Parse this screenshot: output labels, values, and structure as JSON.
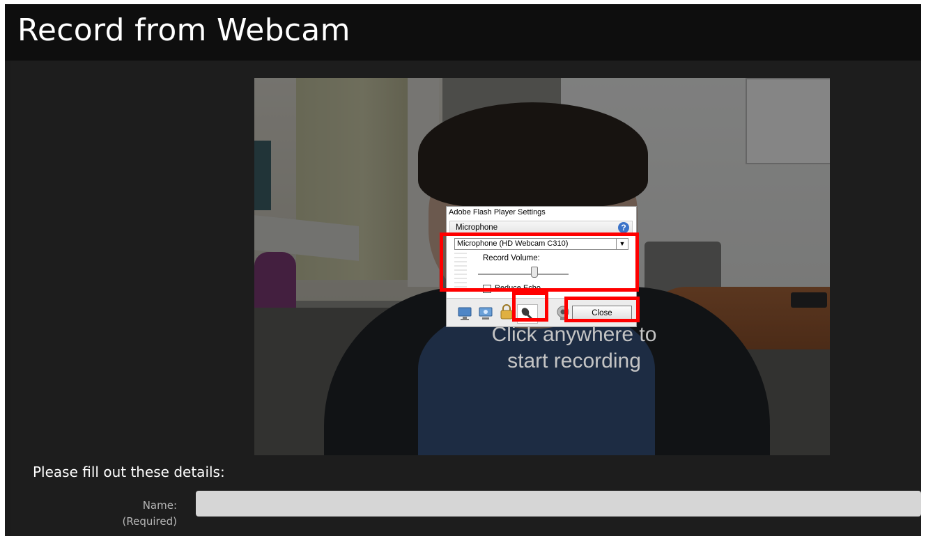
{
  "window": {
    "title": "Record from Webcam"
  },
  "video": {
    "prompt_line1": "Click anywhere to",
    "prompt_line2": "start recording"
  },
  "flash_dialog": {
    "title": "Adobe Flash Player Settings",
    "section": "Microphone",
    "help_icon": "question-circle-icon",
    "microphone_select": {
      "selected": "Microphone (HD Webcam C310)"
    },
    "record_volume_label": "Record Volume:",
    "record_volume_level": 0.62,
    "reduce_echo": {
      "label": "Reduce Echo",
      "checked": false
    },
    "tabs": [
      "privacy-icon",
      "display-icon",
      "storage-icon",
      "microphone-icon",
      "camera-icon"
    ],
    "active_tab": "microphone-icon",
    "close_label": "Close"
  },
  "annotations": {
    "color": "#ff0000"
  },
  "form": {
    "heading": "Please fill out these details:",
    "name_label": "Name:",
    "name_required": "(Required)",
    "name_value": ""
  }
}
